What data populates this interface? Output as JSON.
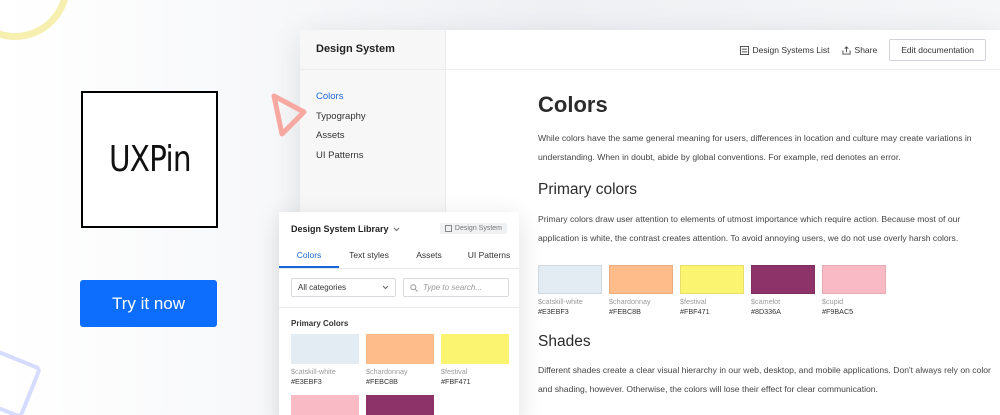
{
  "brand": {
    "logo_text": "UXPin",
    "cta_label": "Try it now"
  },
  "colors": {
    "accent": "#0d6efd",
    "link": "#1a66d9"
  },
  "doc": {
    "title": "Design System",
    "nav": [
      "Colors",
      "Typography",
      "Assets",
      "UI Patterns"
    ],
    "header": {
      "list_label": "Design Systems List",
      "share_label": "Share",
      "edit_label": "Edit documentation"
    },
    "h1": "Colors",
    "intro": "While colors have the same general meaning for users, differences in location and culture may create variations in understanding. When in doubt, abide by global conventions. For example, red denotes an error.",
    "primary_heading": "Primary colors",
    "primary_text": "Primary colors draw user attention to elements of utmost importance which require action. Because most of our application is white, the contrast creates attention. To avoid annoying users, we do not use overly harsh colors.",
    "swatches": [
      {
        "name": "$catskill-white",
        "hex": "#E3EBF3"
      },
      {
        "name": "$chardonnay",
        "hex": "#FEBC8B"
      },
      {
        "name": "$festival",
        "hex": "#FBF471"
      },
      {
        "name": "$camelot",
        "hex": "#8D336A"
      },
      {
        "name": "$cupid",
        "hex": "#F9BAC5"
      }
    ],
    "shades_heading": "Shades",
    "shades_text": "Different shades create a clear visual hierarchy in our web, desktop, and mobile applications. Don't always rely on color and shading, however. Otherwise, the colors will lose their effect for clear communication."
  },
  "library": {
    "title": "Design System Library",
    "badge": "Design System",
    "tabs": [
      "Colors",
      "Text styles",
      "Assets",
      "UI Patterns"
    ],
    "category_select": "All categories",
    "search_placeholder": "Type to search...",
    "section_title": "Primary Colors",
    "swatches": [
      {
        "name": "$catskill-white",
        "hex": "#E3EBF3"
      },
      {
        "name": "$chardonnay",
        "hex": "#FEBC8B"
      },
      {
        "name": "$festival",
        "hex": "#FBF471"
      },
      {
        "name": "",
        "hex": "#F9BAC5"
      },
      {
        "name": "",
        "hex": "#8D336A"
      }
    ]
  }
}
